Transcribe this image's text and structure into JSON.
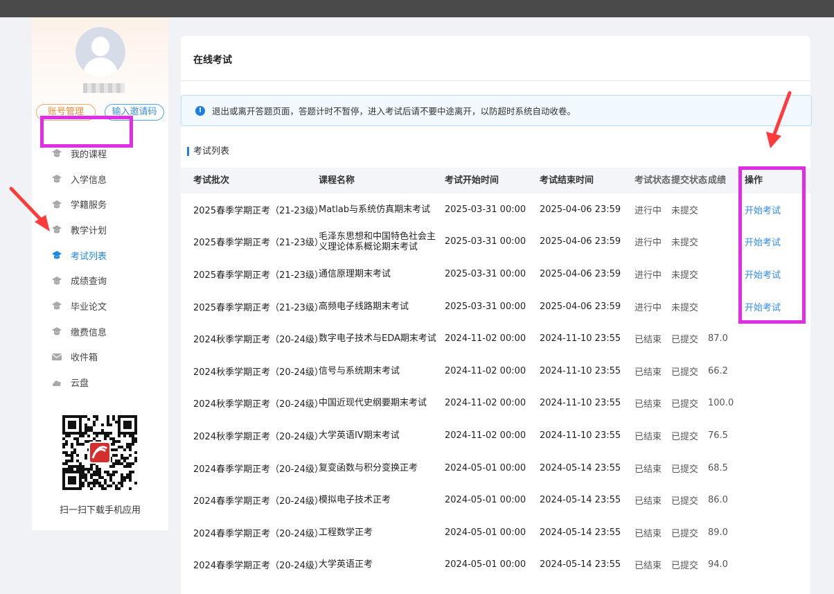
{
  "sidebar": {
    "account_btn": "账号管理",
    "invite_btn": "输入邀请码",
    "items": [
      {
        "label": "我的课程",
        "icon": "graduation-cap-icon"
      },
      {
        "label": "入学信息",
        "icon": "graduation-cap-icon"
      },
      {
        "label": "学籍服务",
        "icon": "graduation-cap-icon"
      },
      {
        "label": "教学计划",
        "icon": "graduation-cap-icon"
      },
      {
        "label": "考试列表",
        "icon": "graduation-cap-icon",
        "active": true
      },
      {
        "label": "成绩查询",
        "icon": "graduation-cap-icon"
      },
      {
        "label": "毕业论文",
        "icon": "graduation-cap-icon"
      },
      {
        "label": "缴费信息",
        "icon": "graduation-cap-icon"
      },
      {
        "label": "收件箱",
        "icon": "mail-icon"
      },
      {
        "label": "云盘",
        "icon": "cloud-icon"
      }
    ],
    "qr_caption": "扫一扫下载手机应用"
  },
  "main": {
    "title": "在线考试",
    "notice": "退出或离开答题页面，答题计时不暂停，进入考试后请不要中途离开，以防超时系统自动收卷。",
    "section_title": "考试列表",
    "columns": {
      "batch": "考试批次",
      "course": "课程名称",
      "start": "考试开始时间",
      "end": "考试结束时间",
      "exam_status": "考试状态",
      "submit_status": "提交状态",
      "score": "成绩",
      "action": "操作"
    },
    "rows": [
      {
        "batch": "2025春季学期正考（21-23级）",
        "course": "Matlab与系统仿真期末考试",
        "start": "2025-03-31 00:00",
        "end": "2025-04-06 23:59",
        "exam_status": "进行中",
        "submit_status": "未提交",
        "score": "",
        "action": "开始考试"
      },
      {
        "batch": "2025春季学期正考（21-23级）",
        "course": "毛泽东思想和中国特色社会主义理论体系概论期末考试",
        "start": "2025-03-31 00:00",
        "end": "2025-04-06 23:59",
        "exam_status": "进行中",
        "submit_status": "未提交",
        "score": "",
        "action": "开始考试"
      },
      {
        "batch": "2025春季学期正考（21-23级）",
        "course": "通信原理期末考试",
        "start": "2025-03-31 00:00",
        "end": "2025-04-06 23:59",
        "exam_status": "进行中",
        "submit_status": "未提交",
        "score": "",
        "action": "开始考试"
      },
      {
        "batch": "2025春季学期正考（21-23级）",
        "course": "高频电子线路期末考试",
        "start": "2025-03-31 00:00",
        "end": "2025-04-06 23:59",
        "exam_status": "进行中",
        "submit_status": "未提交",
        "score": "",
        "action": "开始考试"
      },
      {
        "batch": "2024秋季学期正考（20-24级）",
        "course": "数字电子技术与EDA期末考试",
        "start": "2024-11-02 00:00",
        "end": "2024-11-10 23:55",
        "exam_status": "已结束",
        "submit_status": "已提交",
        "score": "87.0",
        "action": ""
      },
      {
        "batch": "2024秋季学期正考（20-24级）",
        "course": "信号与系统期末考试",
        "start": "2024-11-02 00:00",
        "end": "2024-11-10 23:55",
        "exam_status": "已结束",
        "submit_status": "已提交",
        "score": "66.2",
        "action": ""
      },
      {
        "batch": "2024秋季学期正考（20-24级）",
        "course": "中国近现代史纲要期末考试",
        "start": "2024-11-02 00:00",
        "end": "2024-11-10 23:55",
        "exam_status": "已结束",
        "submit_status": "已提交",
        "score": "100.0",
        "action": ""
      },
      {
        "batch": "2024秋季学期正考（20-24级）",
        "course": "大学英语IV期末考试",
        "start": "2024-11-02 00:00",
        "end": "2024-11-10 23:55",
        "exam_status": "已结束",
        "submit_status": "已提交",
        "score": "76.5",
        "action": ""
      },
      {
        "batch": "2024春季学期正考（20-24级）",
        "course": "复变函数与积分变换正考",
        "start": "2024-05-01 00:00",
        "end": "2024-05-14 23:55",
        "exam_status": "已结束",
        "submit_status": "已提交",
        "score": "68.5",
        "action": ""
      },
      {
        "batch": "2024春季学期正考（20-24级）",
        "course": "模拟电子技术正考",
        "start": "2024-05-01 00:00",
        "end": "2024-05-14 23:55",
        "exam_status": "已结束",
        "submit_status": "已提交",
        "score": "86.0",
        "action": ""
      },
      {
        "batch": "2024春季学期正考（20-24级）",
        "course": "工程数学正考",
        "start": "2024-05-01 00:00",
        "end": "2024-05-14 23:55",
        "exam_status": "已结束",
        "submit_status": "已提交",
        "score": "89.0",
        "action": ""
      },
      {
        "batch": "2024春季学期正考（20-24级）",
        "course": "大学英语正考",
        "start": "2024-05-01 00:00",
        "end": "2024-05-14 23:55",
        "exam_status": "已结束",
        "submit_status": "已提交",
        "score": "94.0",
        "action": ""
      }
    ]
  },
  "colors": {
    "accent": "#1e88e5",
    "highlight": "#e22de6",
    "arrow": "#ff3b3b",
    "link": "#2d8cf0"
  }
}
